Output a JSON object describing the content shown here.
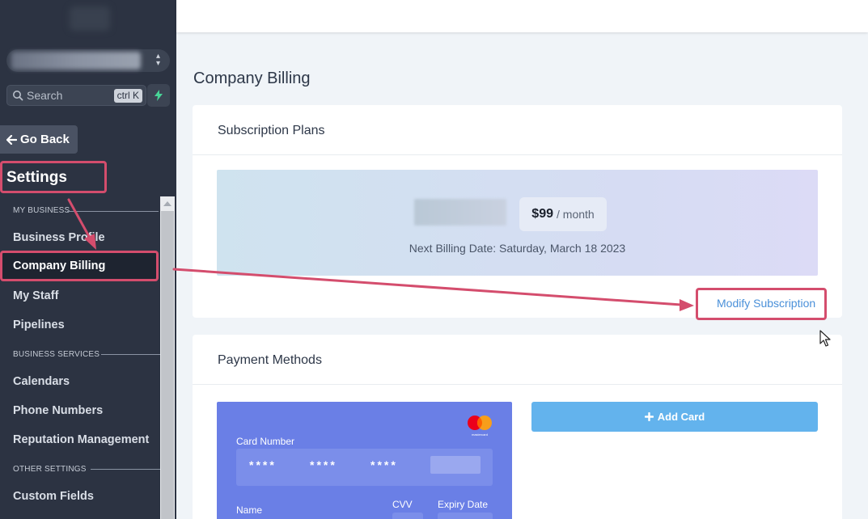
{
  "sidebar": {
    "account_switcher": {
      "arrows": "⌃⌄"
    },
    "search": {
      "placeholder": "Search",
      "shortcut": "ctrl K"
    },
    "go_back_label": "Go Back",
    "settings_title": "Settings",
    "sections": {
      "my_business": "MY BUSINESS",
      "business_services": "BUSINESS SERVICES",
      "other_settings": "OTHER SETTINGS"
    },
    "items": {
      "business_profile": "Business Profile",
      "company_billing": "Company Billing",
      "my_staff": "My Staff",
      "pipelines": "Pipelines",
      "calendars": "Calendars",
      "phone_numbers": "Phone Numbers",
      "reputation_management": "Reputation Management",
      "custom_fields": "Custom Fields"
    },
    "colors": {
      "bg": "#2c3342",
      "active": "#1e2430"
    }
  },
  "main": {
    "page_title": "Company Billing",
    "subscription": {
      "header": "Subscription Plans",
      "price": "$99",
      "period": "/ month",
      "next_billing": "Next Billing Date: Saturday, March 18 2023",
      "modify_link": "Modify Subscription"
    },
    "payment": {
      "header": "Payment Methods",
      "card": {
        "brand": "mastercard",
        "number_label": "Card Number",
        "groups": [
          "****",
          "****",
          "****"
        ],
        "name_label": "Name",
        "cvv_label": "CVV",
        "expiry_label": "Expiry Date"
      },
      "add_card_label": "Add Card"
    }
  },
  "colors": {
    "accent_link": "#4a90d9",
    "add_card_btn": "#63b3ed",
    "card_bg": "#6a7fe6",
    "annotation": "#d44d6d"
  }
}
